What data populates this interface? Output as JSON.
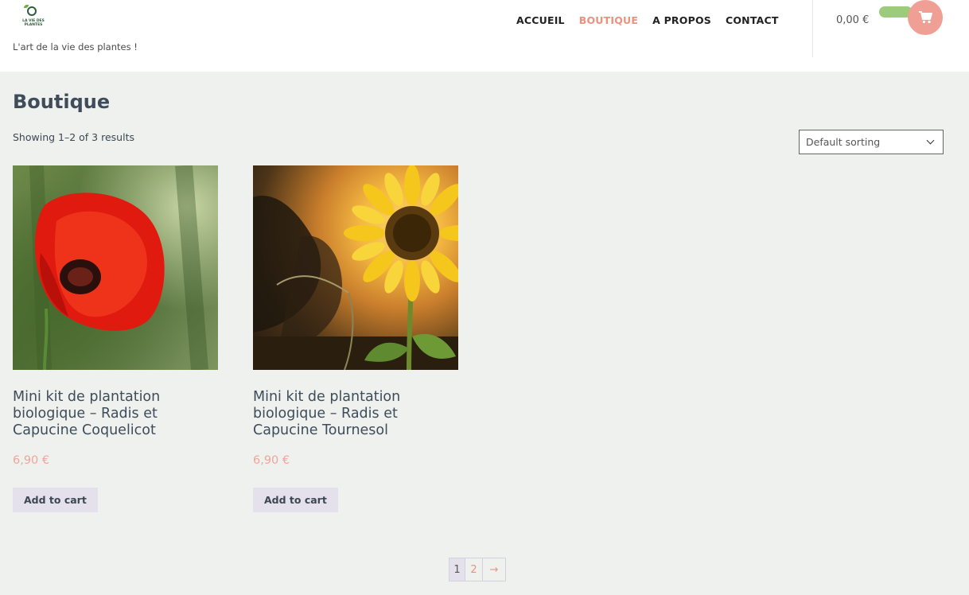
{
  "header": {
    "logo_text": "LA VIE DES PLANTES",
    "tagline": "L'art de la vie des plantes !",
    "nav": [
      {
        "label": "ACCUEIL",
        "active": false
      },
      {
        "label": "BOUTIQUE",
        "active": true
      },
      {
        "label": "A PROPOS",
        "active": false
      },
      {
        "label": "CONTACT",
        "active": false
      }
    ],
    "cart_total": "0,00 €",
    "cart_icon": "cart-icon",
    "accent_color": "#ef9f93",
    "pill_color": "#9ccb7c"
  },
  "main": {
    "title": "Boutique",
    "result_count": "Showing 1–2 of 3 results",
    "sorting": {
      "selected": "Default sorting"
    }
  },
  "products": [
    {
      "title": "Mini kit de plantation biologique – Radis et Capucine Coquelicot",
      "price": "6,90 €",
      "button": "Add to cart",
      "image": "red-poppy-photo"
    },
    {
      "title": "Mini kit de plantation biologique – Radis et Capucine Tournesol",
      "price": "6,90 €",
      "button": "Add to cart",
      "image": "sunflower-photo"
    }
  ],
  "pagination": {
    "current": "1",
    "page2": "2",
    "next": "→"
  },
  "colors": {
    "price": "#f0a59a",
    "active_nav": "#e9927f",
    "background": "#eef1ee"
  }
}
